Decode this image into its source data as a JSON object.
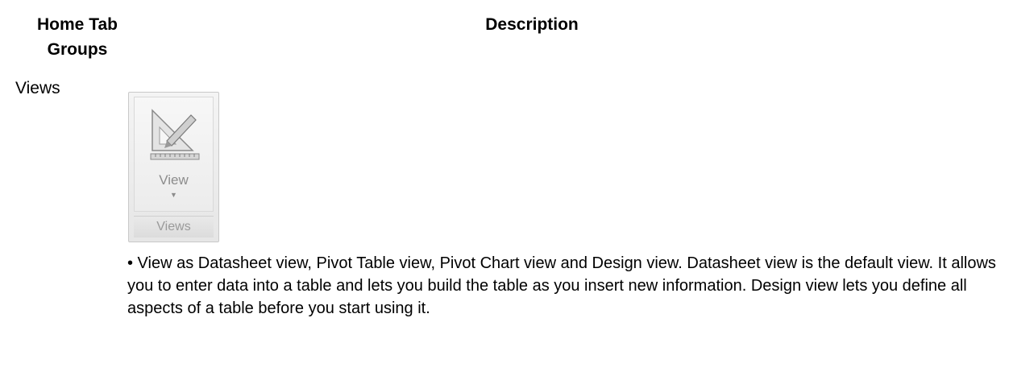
{
  "headers": {
    "group_line1": "Home Tab",
    "group_line2": "Groups",
    "description": "Description"
  },
  "row": {
    "group_name": "Views",
    "ribbon": {
      "button_label": "View",
      "group_label": "Views",
      "icon": "view-design-icon"
    },
    "description": "• View as Datasheet view, Pivot Table view, Pivot Chart view and Design view. Datasheet view is the default view. It allows you to enter data into a table and lets you build the table as you insert new information. Design view lets you define all aspects of a table before you start using it."
  }
}
